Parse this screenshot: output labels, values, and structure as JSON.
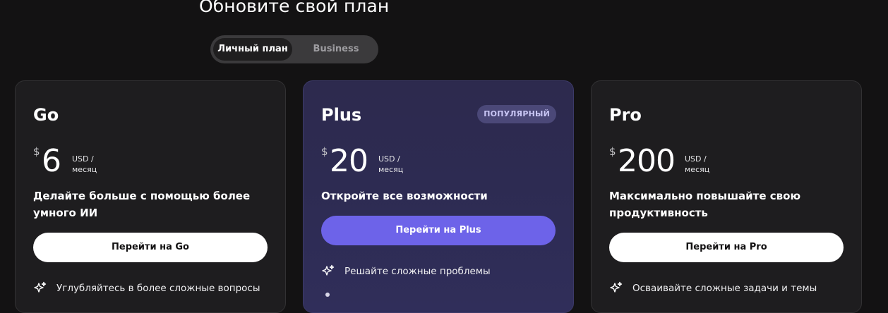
{
  "page": {
    "title": "Обновите свой план"
  },
  "toggle": {
    "personal_label": "Личный план",
    "business_label": "Business",
    "selected": "Личный план"
  },
  "plans": [
    {
      "name": "Go",
      "currency": "$",
      "price": "6",
      "period_line1": "USD /",
      "period_line2": "месяц",
      "tagline": "Делайте больше с помощью более умного ИИ",
      "cta_label": "Перейти на Go",
      "features": [
        {
          "icon": "sparkle-icon",
          "text": "Углубляйтесь в более сложные вопросы"
        }
      ]
    },
    {
      "name": "Plus",
      "badge": "ПОПУЛЯРНЫЙ",
      "currency": "$",
      "price": "20",
      "period_line1": "USD /",
      "period_line2": "месяц",
      "tagline": "Откройте все возможности",
      "cta_label": "Перейти на Plus",
      "features": [
        {
          "icon": "sparkle-icon",
          "text": "Решайте сложные проблемы"
        }
      ]
    },
    {
      "name": "Pro",
      "currency": "$",
      "price": "200",
      "period_line1": "USD /",
      "period_line2": "месяц",
      "tagline": "Максимально повышайте свою продуктивность",
      "cta_label": "Перейти на Pro",
      "features": [
        {
          "icon": "sparkle-icon",
          "text": "Осваивайте сложные задачи и темы"
        }
      ]
    }
  ],
  "colors": {
    "background": "#131213",
    "card": "#1e1d1f",
    "plus_card": "#2d2b52",
    "accent": "#6d63e9",
    "badge": "#4b4878"
  }
}
